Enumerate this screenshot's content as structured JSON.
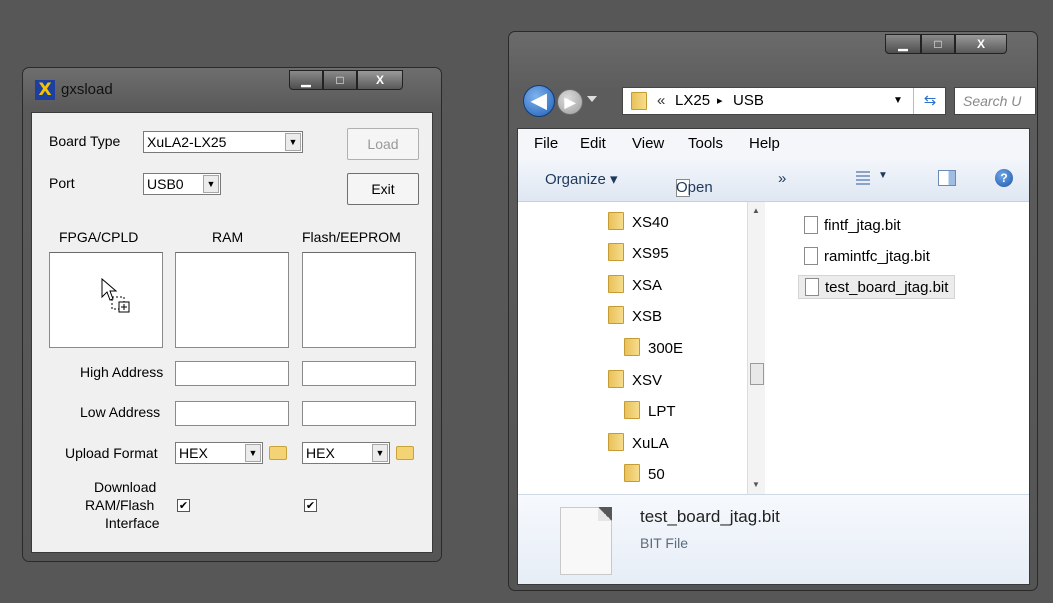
{
  "gxsload": {
    "title": "gxsload",
    "caption_buttons": {
      "minimize": "▁",
      "maximize": "□",
      "close": "X"
    },
    "board_type_label": "Board Type",
    "board_type_value": "XuLA2-LX25",
    "port_label": "Port",
    "port_value": "USB0",
    "load_label": "Load",
    "exit_label": "Exit",
    "col_fpga": "FPGA/CPLD",
    "col_ram": "RAM",
    "col_flash": "Flash/EEPROM",
    "high_address_label": "High Address",
    "low_address_label": "Low Address",
    "upload_format_label": "Upload Format",
    "upload_format_ram": "HEX",
    "upload_format_flash": "HEX",
    "download_label_1": "Download",
    "download_label_2": "RAM/Flash",
    "download_label_3": "Interface",
    "ram_checked": "✔",
    "flash_checked": "✔"
  },
  "explorer": {
    "caption_buttons": {
      "minimize": "▁",
      "maximize": "□",
      "close": "X"
    },
    "breadcrumb_prefix": "«",
    "crumb_1": "LX25",
    "crumb_sep": "▸",
    "crumb_2": "USB",
    "search_placeholder": "Search U",
    "menu": [
      "File",
      "Edit",
      "View",
      "Tools",
      "Help"
    ],
    "organize_label": "Organize ▾",
    "open_label": "Open",
    "more_label": "»",
    "tree": [
      "XS40",
      "XS95",
      "XSA",
      "XSB",
      "300E",
      "XSV",
      "LPT",
      "XuLA",
      "50"
    ],
    "files": [
      "fintf_jtag.bit",
      "ramintfc_jtag.bit",
      "test_board_jtag.bit"
    ],
    "selected_name": "test_board_jtag.bit",
    "selected_type": "BIT File"
  }
}
